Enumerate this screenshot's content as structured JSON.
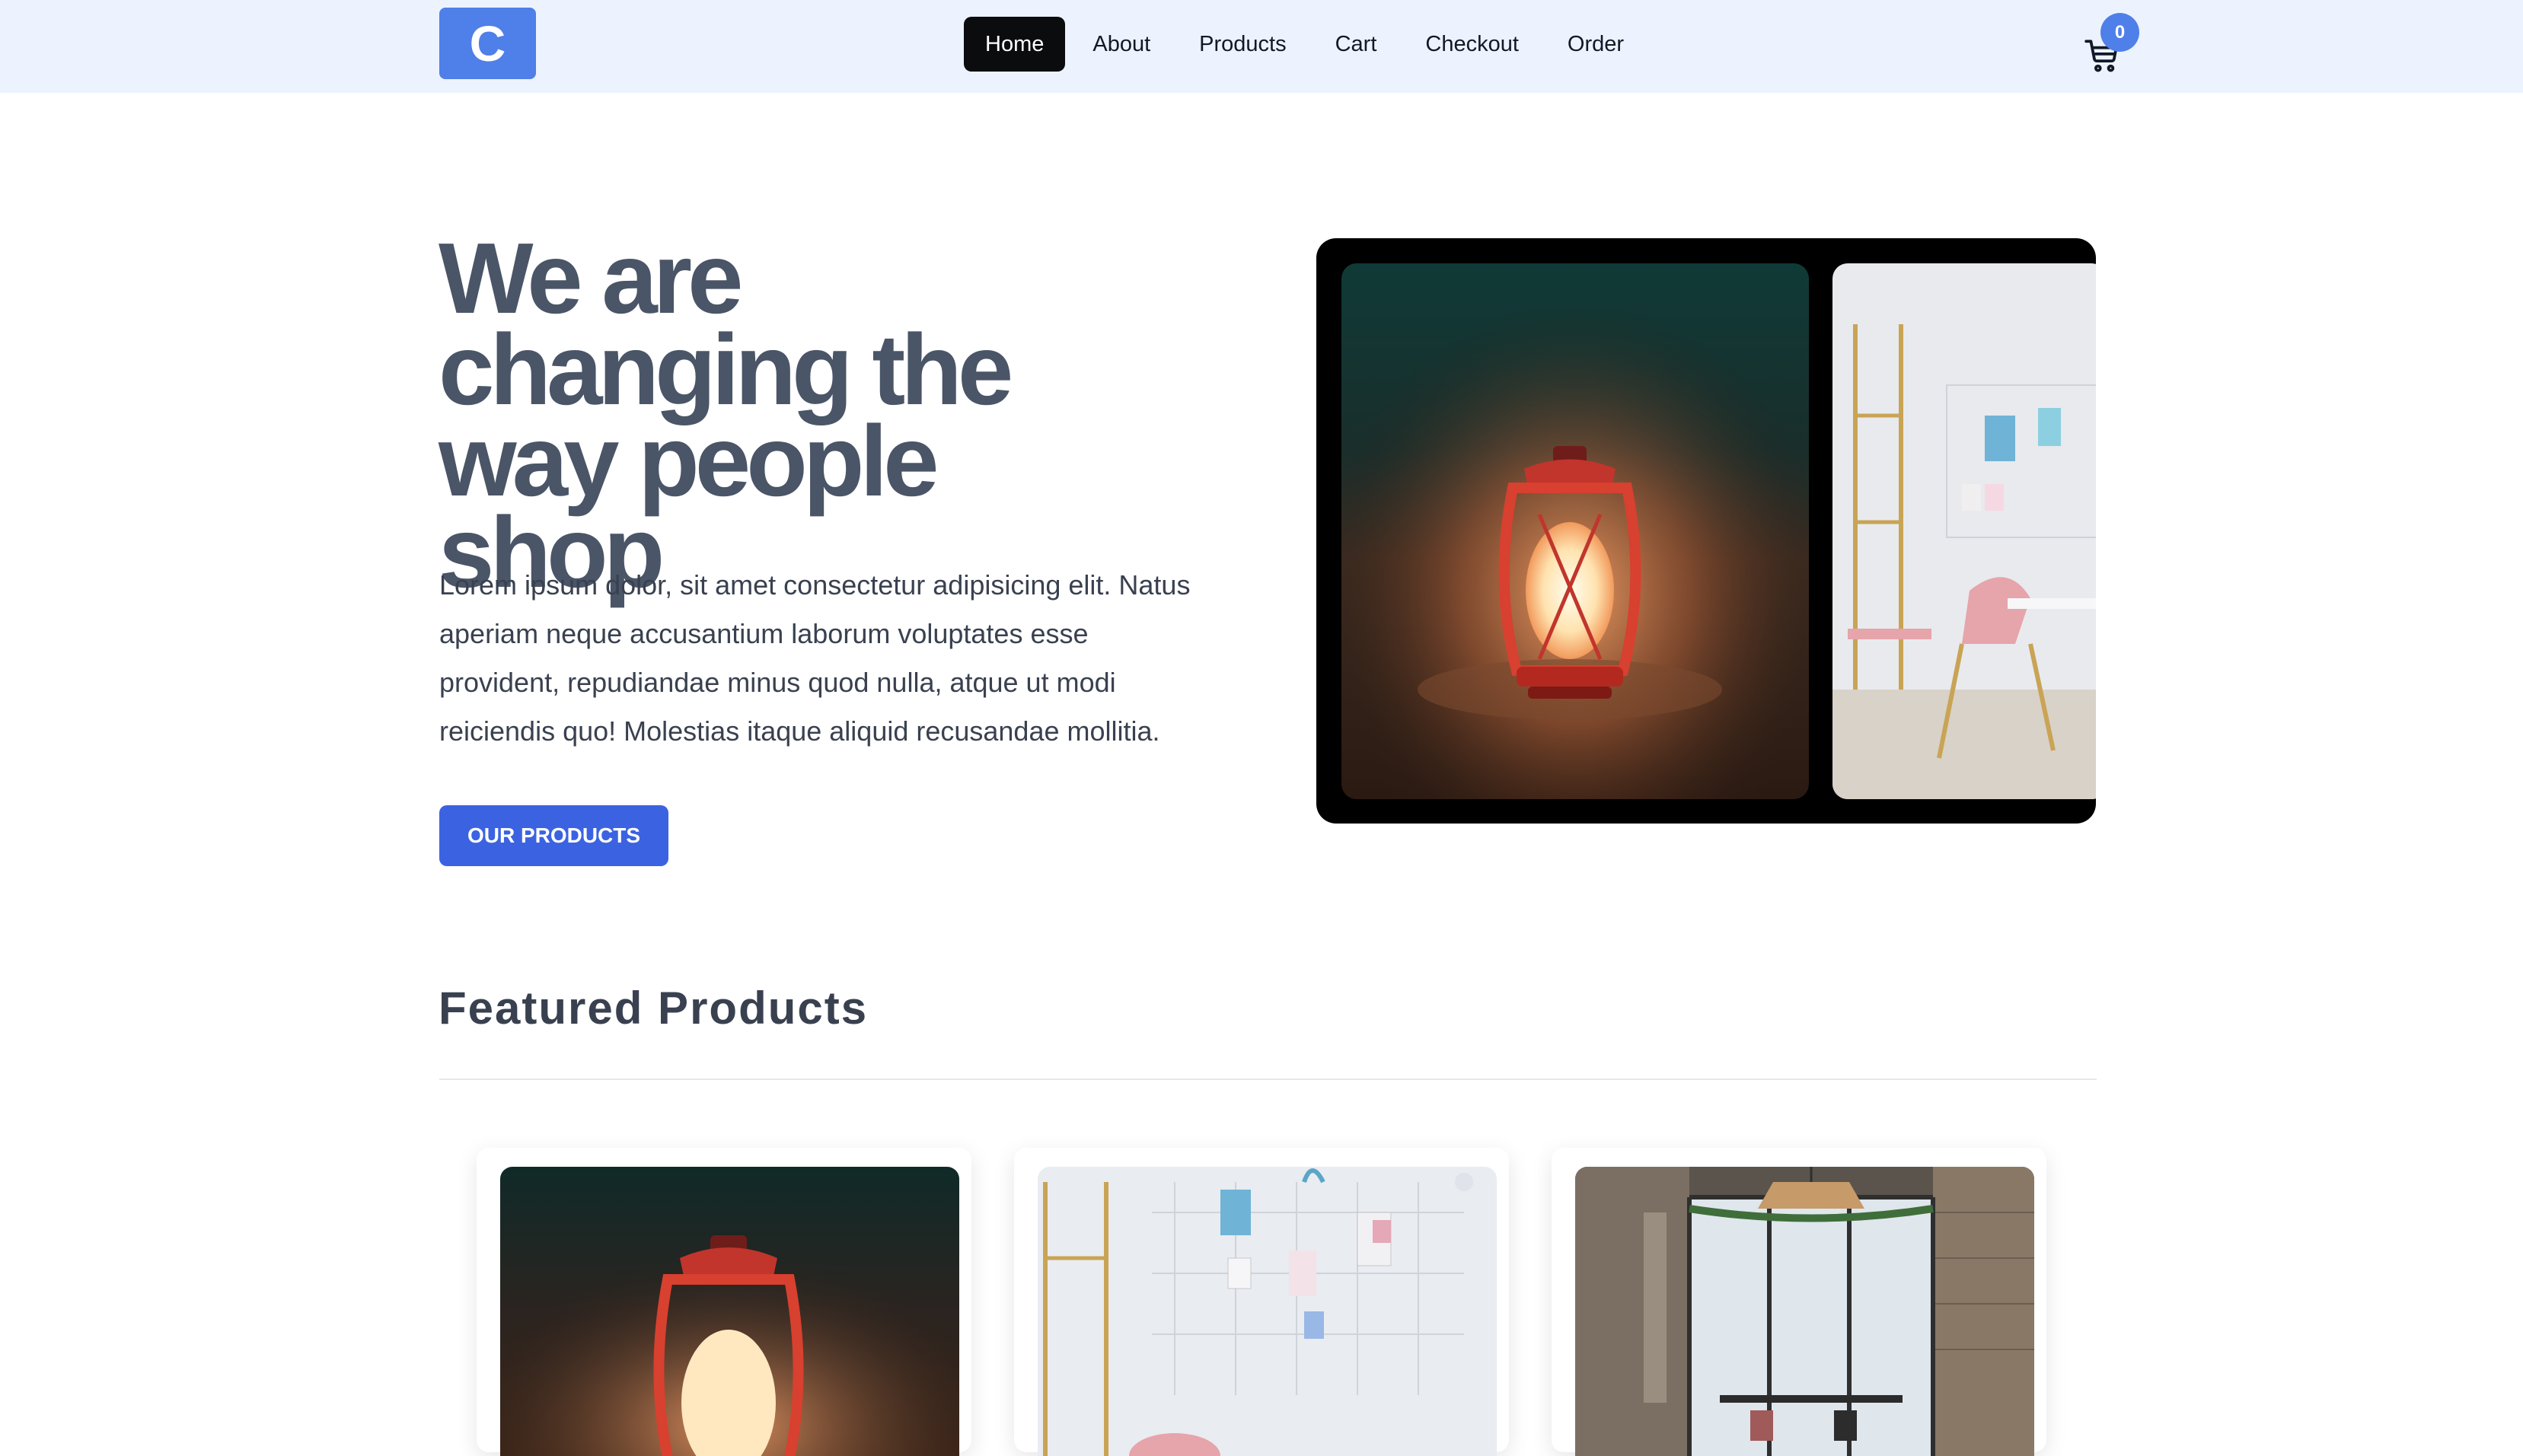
{
  "navbar": {
    "logo_letter": "C",
    "links": [
      {
        "label": "Home",
        "active": true
      },
      {
        "label": "About",
        "active": false
      },
      {
        "label": "Products",
        "active": false
      },
      {
        "label": "Cart",
        "active": false
      },
      {
        "label": "Checkout",
        "active": false
      },
      {
        "label": "Order",
        "active": false
      }
    ],
    "cart_count": "0",
    "cart_icon": "cart-icon"
  },
  "hero": {
    "title": "We are changing the way people shop",
    "text": "Lorem ipsum dolor, sit amet consectetur adipisicing elit. Natus aperiam neque accusantium laborum voluptates esse provident, repudiandae minus quod nulla, atque ut modi reiciendis quo! Molestias itaque aliquid recusandae mollitia.",
    "button_label": "OUR PRODUCTS",
    "carousel_images": [
      "lantern-on-sand-image",
      "white-office-desk-image"
    ]
  },
  "featured": {
    "title": "Featured Products",
    "products": [
      {
        "image": "lantern-product-image"
      },
      {
        "image": "wall-grid-desk-product-image"
      },
      {
        "image": "industrial-cafe-product-image"
      }
    ]
  },
  "colors": {
    "navbar_bg": "#ecf3fe",
    "brand_blue": "#4f7fe9",
    "button_blue": "#3b63e1",
    "active_nav": "#0b0c0e",
    "heading_text": "#4a5567"
  }
}
